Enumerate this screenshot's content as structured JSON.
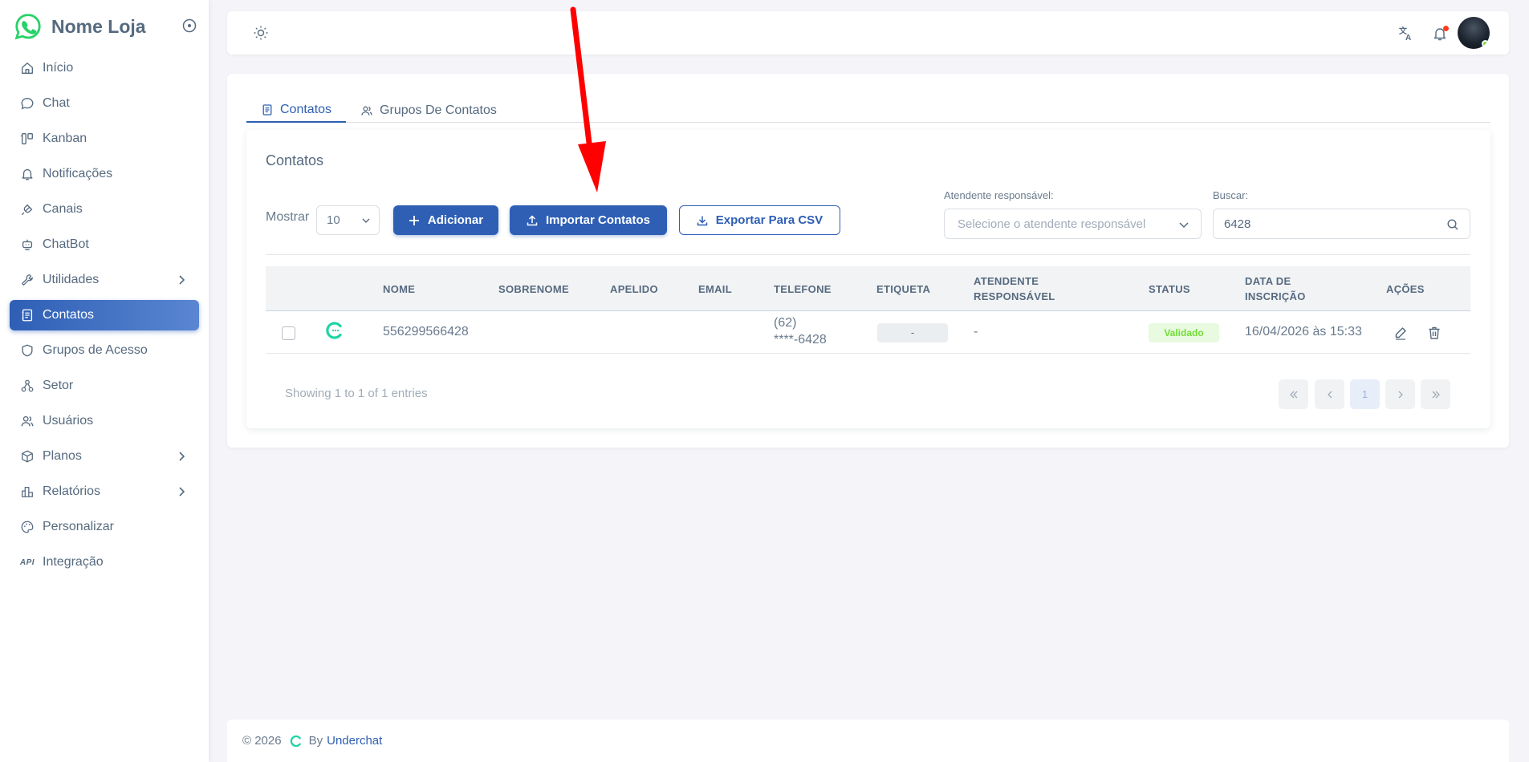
{
  "brand": {
    "name": "Nome Loja"
  },
  "sidebar": {
    "items": [
      {
        "label": "Início",
        "icon": "home-icon"
      },
      {
        "label": "Chat",
        "icon": "chat-icon"
      },
      {
        "label": "Kanban",
        "icon": "kanban-icon"
      },
      {
        "label": "Notificações",
        "icon": "bell-icon"
      },
      {
        "label": "Canais",
        "icon": "plug-icon"
      },
      {
        "label": "ChatBot",
        "icon": "robot-icon"
      },
      {
        "label": "Utilidades",
        "icon": "tools-icon",
        "has_submenu": true
      },
      {
        "label": "Contatos",
        "icon": "contacts-icon",
        "active": true
      },
      {
        "label": "Grupos de Acesso",
        "icon": "shield-icon"
      },
      {
        "label": "Setor",
        "icon": "sitemap-icon"
      },
      {
        "label": "Usuários",
        "icon": "users-icon"
      },
      {
        "label": "Planos",
        "icon": "box-icon",
        "has_submenu": true
      },
      {
        "label": "Relatórios",
        "icon": "bar-chart-icon",
        "has_submenu": true
      },
      {
        "label": "Personalizar",
        "icon": "palette-icon"
      },
      {
        "label": "Integração",
        "icon": "api-icon",
        "icon_text": "API"
      }
    ]
  },
  "tabs": [
    {
      "label": "Contatos",
      "active": true
    },
    {
      "label": "Grupos De Contatos",
      "active": false
    }
  ],
  "card": {
    "title": "Contatos",
    "show_label": "Mostrar",
    "page_size": "10",
    "add_label": "Adicionar",
    "import_label": "Importar Contatos",
    "export_label": "Exportar Para CSV",
    "attendant_label": "Atendente responsável:",
    "attendant_placeholder": "Selecione o atendente responsável",
    "search_label": "Buscar:",
    "search_value": "6428"
  },
  "table": {
    "headers": [
      "Nome",
      "Sobrenome",
      "Apelido",
      "Email",
      "Telefone",
      "Etiqueta",
      "Atendente Responsável",
      "Status",
      "Data de Inscrição",
      "Ações"
    ],
    "rows": [
      {
        "nome": "556299566428",
        "sobrenome": "",
        "apelido": "",
        "email": "",
        "telefone_line1": "(62)",
        "telefone_line2": "****-6428",
        "etiqueta": "-",
        "atendente": "-",
        "status": "Validado",
        "data": "16/04/2026 às 15:33"
      }
    ],
    "info": "Showing 1 to 1 of 1 entries",
    "pagination": {
      "current_page": "1"
    }
  },
  "footer": {
    "copyright": "© 2026",
    "by": "By",
    "link": "Underchat"
  },
  "colors": {
    "primary": "#2e5fb5",
    "brand_green": "#25d366",
    "status_green": "#71dd37",
    "annotation_red": "#ff0000",
    "logo_teal": "#1ed4a4"
  }
}
